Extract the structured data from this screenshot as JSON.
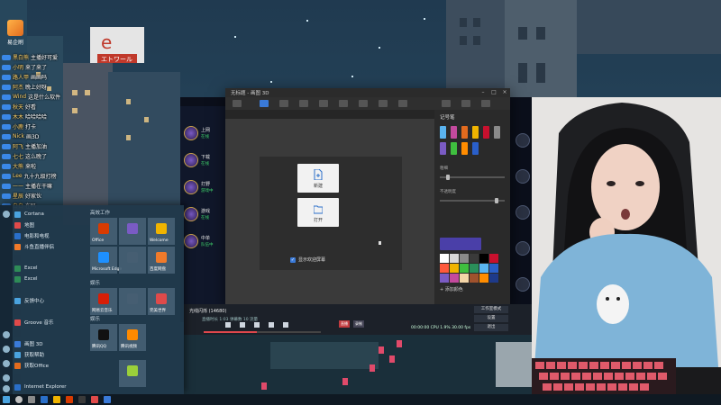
{
  "desktop": {
    "icon_label": "易企刷"
  },
  "chat": [
    {
      "name": "黑白熊",
      "text": "主播好可爱"
    },
    {
      "name": "小明",
      "text": "来了来了"
    },
    {
      "name": "路人甲",
      "text": "画画吗"
    },
    {
      "name": "阿杰",
      "text": "晚上好呀"
    },
    {
      "name": "Wind",
      "text": "这是什么软件"
    },
    {
      "name": "秋天",
      "text": "好看"
    },
    {
      "name": "木木",
      "text": "哈哈哈哈"
    },
    {
      "name": "小鹿",
      "text": "打卡"
    },
    {
      "name": "Nick",
      "text": "画3D"
    },
    {
      "name": "阿飞",
      "text": "主播加油"
    },
    {
      "name": "七七",
      "text": "这么晚了"
    },
    {
      "name": "大熊",
      "text": "来啦"
    },
    {
      "name": "Lee",
      "text": "九十九级打榜"
    },
    {
      "name": "一一",
      "text": "主播在干嘛"
    },
    {
      "name": "星辰",
      "text": "好家伙"
    },
    {
      "name": "白白",
      "text": "在吗"
    }
  ],
  "start_menu": {
    "apps": [
      {
        "label": "Cortana",
        "color": "#4aa3df"
      },
      {
        "label": "地图",
        "color": "#e04a4a"
      },
      {
        "label": "电影和电视",
        "color": "#2a6fc9"
      },
      {
        "label": "斗鱼直播伴侣",
        "color": "#f07a2a"
      },
      {
        "label": "",
        "color": "#20384a"
      },
      {
        "label": "Excel",
        "color": "#2e8b57"
      },
      {
        "label": "Excel",
        "color": "#2e8b57"
      },
      {
        "label": "",
        "color": "#20384a"
      },
      {
        "label": "反馈中心",
        "color": "#4aa3df"
      },
      {
        "label": "",
        "color": "#20384a"
      },
      {
        "label": "Groove 音乐",
        "color": "#e04a4a"
      },
      {
        "label": "",
        "color": "#20384a"
      },
      {
        "label": "画图 3D",
        "color": "#3a7ad8"
      },
      {
        "label": "获取帮助",
        "color": "#4aa3df"
      },
      {
        "label": "获取Office",
        "color": "#e26b1e"
      },
      {
        "label": "",
        "color": "#20384a"
      },
      {
        "label": "Internet Explorer",
        "color": "#2a6fc9"
      }
    ],
    "tile_groups": [
      "高效工作",
      "娱乐",
      "娱乐"
    ],
    "tiles": [
      {
        "label": "Office",
        "color": "#d83b01"
      },
      {
        "label": "",
        "color": "#7a5bc4"
      },
      {
        "label": "Welcome",
        "color": "#f0b400"
      },
      {
        "label": "Microsoft Edge",
        "color": "#1e90ff"
      },
      {
        "label": "",
        "color": "#465e72"
      },
      {
        "label": "百度网盘",
        "color": "#f07a2a"
      },
      {
        "label": "网易云音乐",
        "color": "#d81e06"
      },
      {
        "label": "",
        "color": "#465e72"
      },
      {
        "label": "完美世界",
        "color": "#e04a4a"
      },
      {
        "label": "腾讯QQ",
        "color": "#111111"
      },
      {
        "label": "腾讯视频",
        "color": "#ff8a00"
      },
      {
        "label": "",
        "color": "#9bcf3a"
      }
    ]
  },
  "game_client": {
    "friends": [
      {
        "name": "上网",
        "status": "在线"
      },
      {
        "name": "下载",
        "status": "在线"
      },
      {
        "name": "打野",
        "status": "游戏中"
      },
      {
        "name": "游戏",
        "status": "在线"
      },
      {
        "name": "中单",
        "status": "队伍中"
      }
    ]
  },
  "paint": {
    "title": "无标题 - 画图 3D",
    "welcome": {
      "new_label": "新建",
      "open_label": "打开",
      "show_welcome_label": "显示欢迎屏幕"
    },
    "panel_title": "记号笔",
    "slider_thickness": "粗细",
    "slider_opacity": "不透明度",
    "slider_thickness_value": 0.1,
    "slider_opacity_value": 0.9,
    "current_color": "#4a3fa8",
    "palette": [
      "#ffffff",
      "#d8d8d8",
      "#8a8a8a",
      "#3a3a3a",
      "#000000",
      "#c8102e",
      "#ff5a3c",
      "#f0b400",
      "#3fbf3f",
      "#2a8f5a",
      "#5ab4f0",
      "#2a5fc9",
      "#7a5bc4",
      "#c44a9e",
      "#f5d6a8",
      "#a0522d",
      "#ff8c00",
      "#1e3a8a"
    ],
    "add_color_label": "+ 添加颜色"
  },
  "obs": {
    "track": "光线闪烁 (14680)",
    "sub": "直播时长 1:03 弹幕数 10 流量 ",
    "progress": 0.45,
    "tags": [
      "直播",
      "录制"
    ],
    "stats": "00:00:00  CPU 1.9%  30.00 fps",
    "buttons": [
      "工作室模式",
      "设置",
      "退出"
    ]
  },
  "colors": {
    "accent": "#3a7ad8",
    "taskbar": "#0f1922",
    "start_menu_bg": "#20384a"
  }
}
